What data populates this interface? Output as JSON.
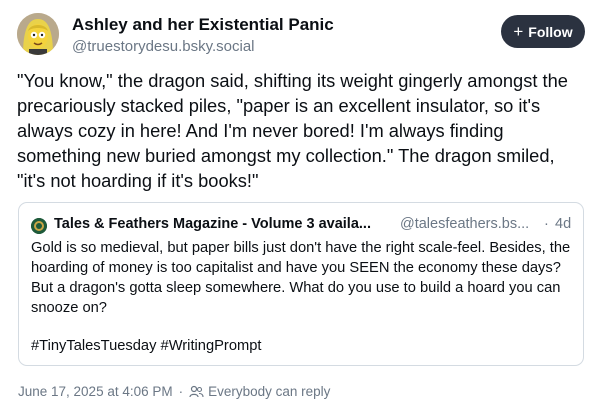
{
  "author": {
    "name": "Ashley and her Existential Panic",
    "handle": "@truestorydesu.bsky.social"
  },
  "follow_button": {
    "label": "Follow",
    "icon": "plus-icon"
  },
  "post": {
    "text": "\"You know,\" the dragon said, shifting its weight gingerly amongst the precariously stacked piles, \"paper is an excellent insulator, so it's always cozy in here! And I'm never bored! I'm always finding something new buried amongst my collection.\" The dragon smiled, \"it's not hoarding if it's books!\""
  },
  "quote": {
    "name": "Tales & Feathers Magazine - Volume 3 availa...",
    "handle": "@talesfeathers.bs...",
    "separator": "·",
    "time": "4d",
    "text": "Gold is so medieval, but paper bills just don't have the right scale-feel. Besides, the hoarding of money is too capitalist and have you SEEN the economy these days? But a dragon's gotta sleep somewhere. What do you use to build a hoard you can snooze on?",
    "tags": "#TinyTalesTuesday #WritingPrompt"
  },
  "footer": {
    "timestamp": "June 17, 2025 at 4:06 PM",
    "separator": "·",
    "reply_setting": "Everybody can reply",
    "reply_icon": "people-icon"
  },
  "colors": {
    "follow_bg": "#2b3240",
    "muted_text": "#6b7785",
    "border": "#d4dbe2"
  }
}
